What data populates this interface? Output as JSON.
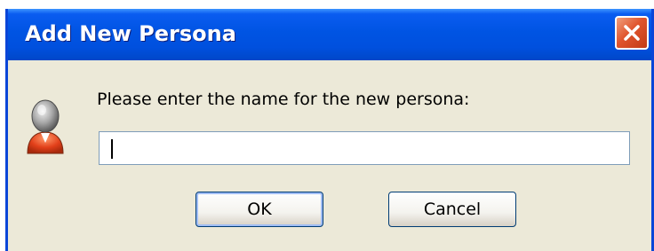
{
  "dialog": {
    "title": "Add New Persona",
    "prompt": "Please enter the name for the new persona:",
    "input": {
      "value": "",
      "placeholder": ""
    },
    "buttons": {
      "ok_label": "OK",
      "cancel_label": "Cancel"
    },
    "icons": {
      "close": "close-icon",
      "avatar": "persona-avatar-icon"
    },
    "colors": {
      "titlebar": "#0054e3",
      "close_button": "#e0552e",
      "body": "#ece9d8"
    }
  }
}
